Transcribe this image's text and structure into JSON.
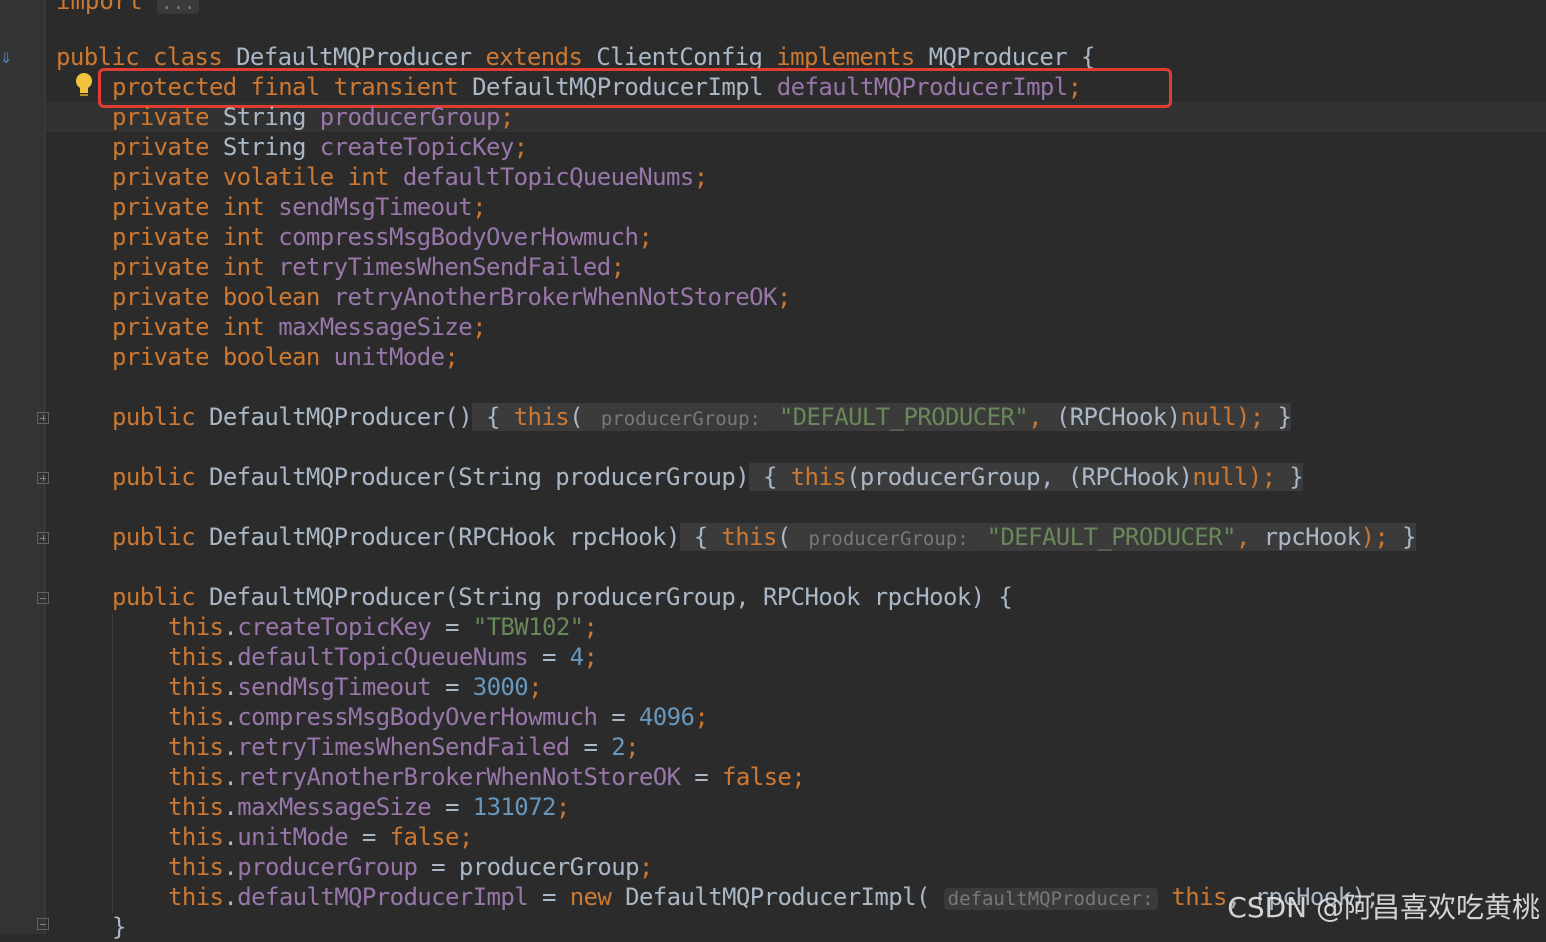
{
  "import_line": {
    "keyword": "import",
    "ellipsis": "..."
  },
  "class_decl": {
    "public": "public",
    "class": "class",
    "name": "DefaultMQProducer",
    "extends": "extends",
    "parent": "ClientConfig",
    "implements": "implements",
    "iface": "MQProducer",
    "brace": "{"
  },
  "highlighted_field": {
    "mods": "protected final transient",
    "type": "DefaultMQProducerImpl",
    "name": "defaultMQProducerImpl",
    "semi": ";"
  },
  "fields": [
    {
      "mods": "private",
      "type": "String",
      "type_is_kw": false,
      "name": "producerGroup"
    },
    {
      "mods": "private",
      "type": "String",
      "type_is_kw": false,
      "name": "createTopicKey"
    },
    {
      "mods": "private volatile",
      "type": "int",
      "type_is_kw": true,
      "name": "defaultTopicQueueNums"
    },
    {
      "mods": "private",
      "type": "int",
      "type_is_kw": true,
      "name": "sendMsgTimeout"
    },
    {
      "mods": "private",
      "type": "int",
      "type_is_kw": true,
      "name": "compressMsgBodyOverHowmuch"
    },
    {
      "mods": "private",
      "type": "int",
      "type_is_kw": true,
      "name": "retryTimesWhenSendFailed"
    },
    {
      "mods": "private",
      "type": "boolean",
      "type_is_kw": true,
      "name": "retryAnotherBrokerWhenNotStoreOK"
    },
    {
      "mods": "private",
      "type": "int",
      "type_is_kw": true,
      "name": "maxMessageSize"
    },
    {
      "mods": "private",
      "type": "boolean",
      "type_is_kw": true,
      "name": "unitMode"
    }
  ],
  "ctor1": {
    "public": "public",
    "sig": "DefaultMQProducer()",
    "open": "{",
    "this": "this",
    "lparen": "(",
    "hint": "producerGroup:",
    "str": "\"DEFAULT_PRODUCER\"",
    "comma": ",",
    "cast": "(RPCHook)",
    "null": "null",
    "end": ");",
    "close": "}"
  },
  "ctor2": {
    "public": "public",
    "sig": "DefaultMQProducer(String producerGroup)",
    "open": "{",
    "this": "this",
    "args": "(producerGroup,",
    "cast": "(RPCHook)",
    "null": "null",
    "end": ");",
    "close": "}"
  },
  "ctor3": {
    "public": "public",
    "sig": "DefaultMQProducer(RPCHook rpcHook)",
    "open": "{",
    "this": "this",
    "lparen": "(",
    "hint": "producerGroup:",
    "str": "\"DEFAULT_PRODUCER\"",
    "comma": ",",
    "arg": "rpcHook",
    "end": ");",
    "close": "}"
  },
  "ctor4": {
    "public": "public",
    "sig": "DefaultMQProducer(String producerGroup, RPCHook rpcHook) {"
  },
  "assignments": [
    {
      "field": "createTopicKey",
      "value": "\"TBW102\"",
      "kind": "str"
    },
    {
      "field": "defaultTopicQueueNums",
      "value": "4",
      "kind": "num"
    },
    {
      "field": "sendMsgTimeout",
      "value": "3000",
      "kind": "num"
    },
    {
      "field": "compressMsgBodyOverHowmuch",
      "value": "4096",
      "kind": "num"
    },
    {
      "field": "retryTimesWhenSendFailed",
      "value": "2",
      "kind": "num"
    },
    {
      "field": "retryAnotherBrokerWhenNotStoreOK",
      "value": "false",
      "kind": "kw"
    },
    {
      "field": "maxMessageSize",
      "value": "131072",
      "kind": "num"
    },
    {
      "field": "unitMode",
      "value": "false",
      "kind": "kw"
    },
    {
      "field": "producerGroup",
      "value": "producerGroup",
      "kind": "id"
    }
  ],
  "last_assign": {
    "this": "this",
    "field": "defaultMQProducerImpl",
    "eq": "=",
    "new": "new",
    "ctor": "DefaultMQProducerImpl(",
    "hint": "defaultMQProducer:",
    "arg_this": "this",
    "rest": ", rpcHook);"
  },
  "closing_brace": "}",
  "watermark": "CSDN @阿昌喜欢吃黄桃"
}
